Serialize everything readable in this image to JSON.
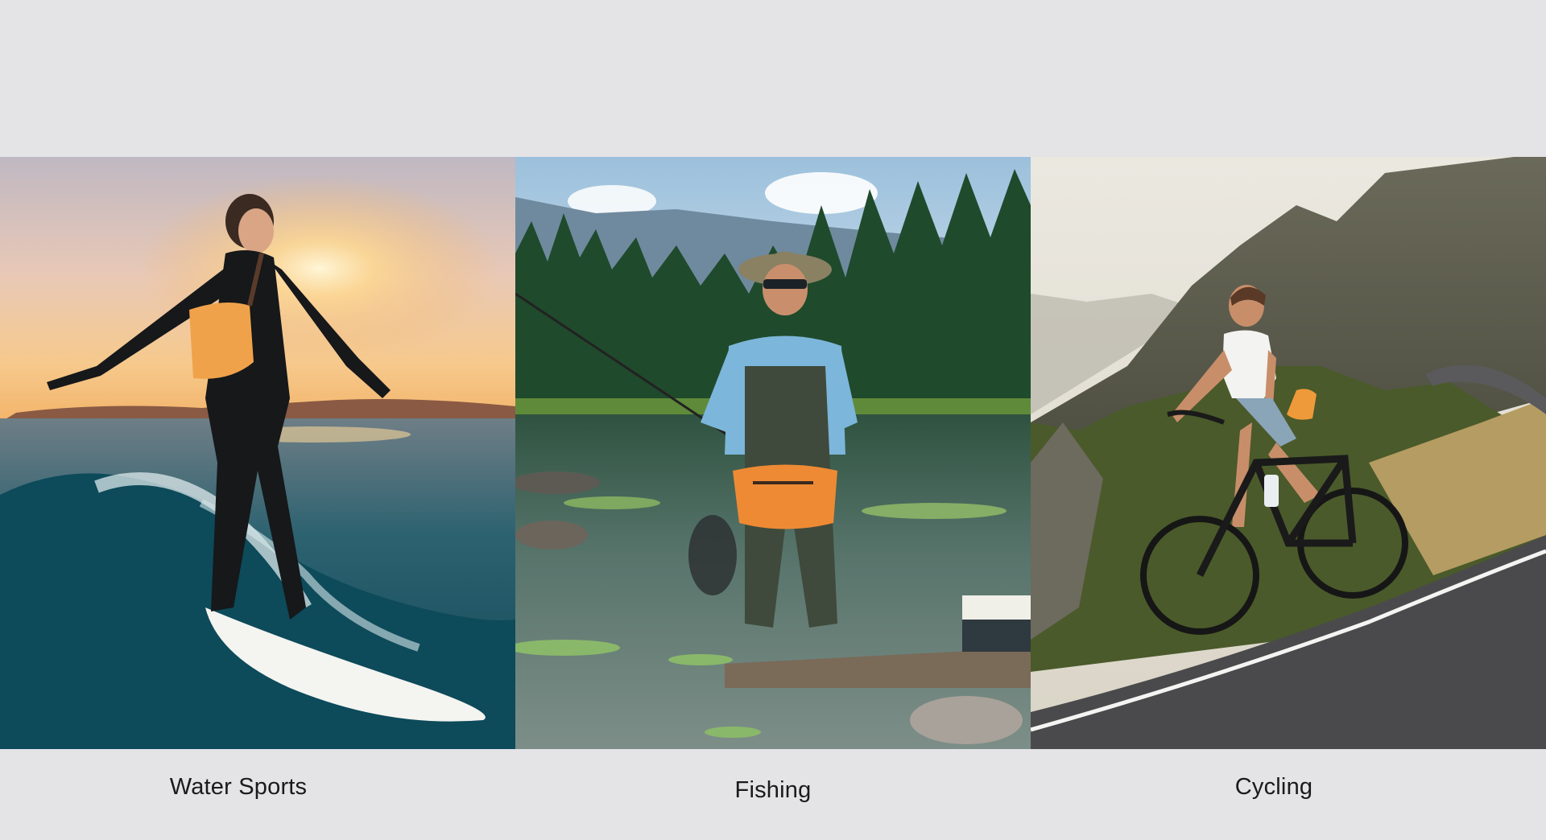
{
  "panels": [
    {
      "caption": "Water Sports",
      "description_icon": "surfer-scene",
      "colors": {
        "sky_top": "#c9c2c6",
        "sky_glow": "#f2c48a",
        "sea": "#1f5968",
        "bag": "#f0a24a"
      }
    },
    {
      "caption": "Fishing",
      "description_icon": "angler-scene",
      "colors": {
        "sky": "#a9c7de",
        "forest": "#1f4a2c",
        "water": "#4d6a62",
        "bag": "#ee8a34"
      }
    },
    {
      "caption": "Cycling",
      "description_icon": "cyclist-scene",
      "colors": {
        "sky": "#e6e1d5",
        "mountain": "#5c5a4a",
        "road": "#4a4a4c",
        "bag": "#ef9a3a"
      }
    }
  ]
}
